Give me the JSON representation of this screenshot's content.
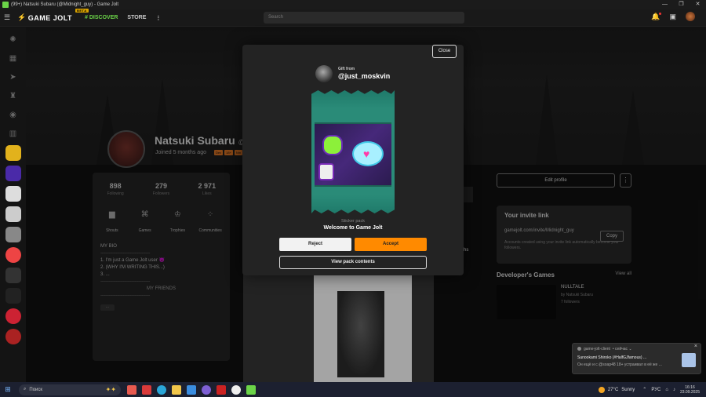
{
  "window": {
    "title": "(99+) Natsuki Subaru (@Midnight_guy) - Game Jolt"
  },
  "appbar": {
    "logo": "GAME JOLT",
    "beta": "BETA",
    "discover": "DISCOVER",
    "store": "STORE",
    "more": "⋮",
    "search_placeholder": "Search"
  },
  "profile": {
    "name": "Natsuki Subaru",
    "handle": "@M",
    "joined": "Joined 5 months ago",
    "badges": [
      "Dev",
      "18+",
      "Nm"
    ],
    "stats": [
      {
        "value": "898",
        "label": "Following"
      },
      {
        "value": "279",
        "label": "Followers"
      },
      {
        "value": "2 971",
        "label": "Likes"
      }
    ],
    "tabs": [
      {
        "label": "Shouts"
      },
      {
        "label": "Games"
      },
      {
        "label": "Trophies"
      },
      {
        "label": "Communities"
      }
    ],
    "bio": {
      "heading": "MY BIO",
      "divider": "------------------------------------------",
      "line1": "1. I'm just a Game Jolt user 😈",
      "line2": "2. (WHY I'M WRITING THIS...)",
      "line3": "3. ...",
      "friends": "MY FRIENDS",
      "more": "..."
    },
    "months_fragment": "nths"
  },
  "right": {
    "edit_profile": "Edit profile",
    "menu": "⋮",
    "invite_title": "Your invite link",
    "invite_link": "gamejolt.com/invite/Midnight_guy",
    "copy": "Copy",
    "invite_note": "Accounts created using your invite link automatically become your followers.",
    "dev_title": "Developer's Games",
    "view_all": "View all",
    "game_title": "NULLTALE",
    "game_by": "by Natsuki Subaru",
    "game_followers": "7 followers"
  },
  "modal": {
    "close": "Close",
    "gift_from": "Gift from",
    "gift_user": "@just_moskvin",
    "pack_type": "Sticker pack",
    "pack_name": "Welcome to Game Jolt",
    "reject": "Reject",
    "accept": "Accept",
    "view_contents": "View pack contents",
    "colors": {
      "accept": "#ff8a00",
      "pack": "#2a8b78"
    }
  },
  "toast": {
    "source": "game-jolt-client",
    "time": "• сейчас ⌄",
    "line1": "Sunookami Shiroko (#HalfGJfamous) ...",
    "line2": "Он ещё и с @soap48 18+ устраивал в её же ...",
    "close": "×"
  },
  "taskbar": {
    "search": "Поиск",
    "temp": "27°C",
    "weather": "Sunny",
    "lang": "РУС",
    "time": "16:16",
    "date": "23.09.2025"
  }
}
